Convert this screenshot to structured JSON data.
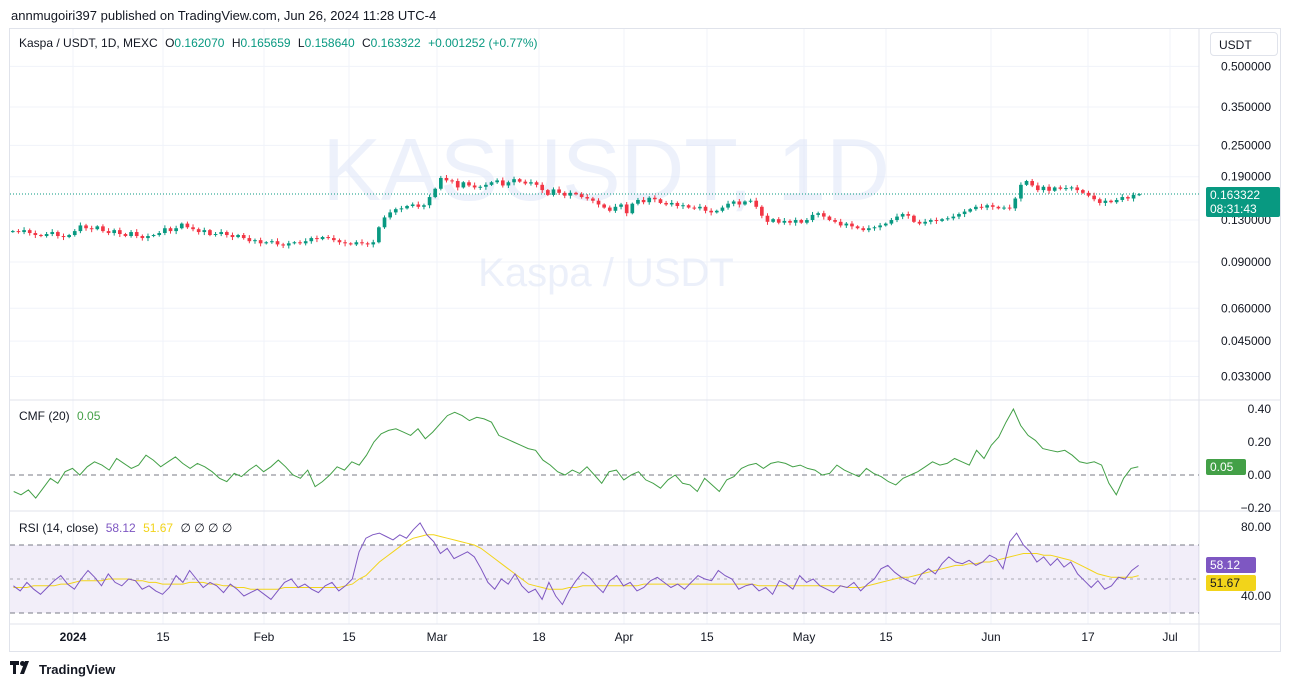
{
  "publisher_line": "annmugoiri397 published on TradingView.com, Jun 26, 2024 11:28 UTC-4",
  "legend": {
    "symbol": "Kaspa / USDT, 1D, MEXC",
    "o_label": "O",
    "o_value": "0.162070",
    "h_label": "H",
    "h_value": "0.165659",
    "l_label": "L",
    "l_value": "0.158640",
    "c_label": "C",
    "c_value": "0.163322",
    "change": "+0.001252 (+0.77%)"
  },
  "currency_button": "USDT",
  "watermark": {
    "line1": "KASUSDT, 1D",
    "line2": "Kaspa / USDT"
  },
  "price_badge": {
    "price": "0.163322",
    "countdown": "08:31:43"
  },
  "cmf": {
    "label": "CMF (20)",
    "value": "0.05"
  },
  "rsi": {
    "label": "RSI (14, close)",
    "value": "58.12",
    "ma_value": "51.67",
    "extras": "∅ ∅ ∅ ∅"
  },
  "footer_brand": "TradingView",
  "colors": {
    "up": "#089981",
    "down": "#f23645",
    "cmf": "#43a047",
    "rsi": "#7e57c2",
    "rsi_ma": "#f2d41a"
  },
  "chart_data": [
    {
      "type": "candlestick",
      "title": "Kaspa / USDT, 1D, MEXC",
      "y_scale": "log",
      "y_ticks": [
        "0.500000",
        "0.350000",
        "0.250000",
        "0.190000",
        "0.130000",
        "0.090000",
        "0.060000",
        "0.045000",
        "0.033000"
      ],
      "x_ticks": [
        "2024",
        "15",
        "Feb",
        "15",
        "Mar",
        "18",
        "Apr",
        "15",
        "May",
        "15",
        "Jun",
        "17",
        "Jul"
      ],
      "close": [
        0.118,
        0.117,
        0.119,
        0.116,
        0.114,
        0.113,
        0.115,
        0.117,
        0.113,
        0.112,
        0.114,
        0.118,
        0.124,
        0.121,
        0.12,
        0.123,
        0.118,
        0.116,
        0.119,
        0.115,
        0.113,
        0.117,
        0.113,
        0.111,
        0.113,
        0.114,
        0.116,
        0.121,
        0.118,
        0.121,
        0.126,
        0.122,
        0.12,
        0.117,
        0.119,
        0.114,
        0.115,
        0.117,
        0.114,
        0.112,
        0.114,
        0.111,
        0.108,
        0.109,
        0.106,
        0.107,
        0.108,
        0.105,
        0.104,
        0.106,
        0.107,
        0.106,
        0.108,
        0.111,
        0.11,
        0.112,
        0.111,
        0.109,
        0.107,
        0.106,
        0.105,
        0.107,
        0.106,
        0.105,
        0.107,
        0.122,
        0.133,
        0.139,
        0.143,
        0.144,
        0.147,
        0.149,
        0.146,
        0.148,
        0.159,
        0.171,
        0.188,
        0.184,
        0.183,
        0.173,
        0.181,
        0.176,
        0.173,
        0.174,
        0.177,
        0.181,
        0.184,
        0.176,
        0.181,
        0.186,
        0.182,
        0.179,
        0.181,
        0.177,
        0.169,
        0.162,
        0.17,
        0.165,
        0.161,
        0.165,
        0.163,
        0.159,
        0.157,
        0.154,
        0.149,
        0.145,
        0.141,
        0.146,
        0.149,
        0.138,
        0.15,
        0.155,
        0.152,
        0.158,
        0.156,
        0.151,
        0.149,
        0.151,
        0.147,
        0.148,
        0.145,
        0.144,
        0.146,
        0.141,
        0.139,
        0.141,
        0.145,
        0.15,
        0.153,
        0.149,
        0.153,
        0.154,
        0.146,
        0.135,
        0.128,
        0.131,
        0.127,
        0.129,
        0.127,
        0.13,
        0.127,
        0.13,
        0.136,
        0.138,
        0.134,
        0.13,
        0.128,
        0.124,
        0.126,
        0.123,
        0.121,
        0.119,
        0.121,
        0.122,
        0.124,
        0.126,
        0.13,
        0.134,
        0.137,
        0.135,
        0.128,
        0.126,
        0.128,
        0.13,
        0.129,
        0.131,
        0.132,
        0.134,
        0.137,
        0.14,
        0.143,
        0.146,
        0.145,
        0.148,
        0.146,
        0.144,
        0.145,
        0.144,
        0.157,
        0.177,
        0.183,
        0.176,
        0.169,
        0.174,
        0.168,
        0.173,
        0.171,
        0.172,
        0.173,
        0.169,
        0.165,
        0.161,
        0.156,
        0.151,
        0.154,
        0.152,
        0.155,
        0.159,
        0.157,
        0.162,
        0.163
      ]
    },
    {
      "type": "line",
      "title": "CMF (20)",
      "y_ticks": [
        "0.40",
        "0.20",
        "0.00",
        "−0.20"
      ],
      "values": [
        -0.1,
        -0.12,
        -0.09,
        -0.14,
        -0.08,
        -0.02,
        -0.05,
        0.02,
        0.04,
        0.0,
        0.05,
        0.08,
        0.06,
        0.03,
        0.1,
        0.07,
        0.04,
        0.06,
        0.12,
        0.09,
        0.05,
        0.08,
        0.11,
        0.07,
        0.04,
        0.07,
        0.05,
        0.02,
        -0.02,
        -0.04,
        0.01,
        -0.01,
        0.03,
        0.06,
        0.02,
        0.05,
        0.09,
        0.05,
        0.0,
        -0.02,
        0.03,
        -0.07,
        -0.04,
        0.0,
        0.05,
        0.03,
        0.08,
        0.06,
        0.12,
        0.2,
        0.25,
        0.27,
        0.28,
        0.26,
        0.24,
        0.28,
        0.22,
        0.26,
        0.31,
        0.36,
        0.38,
        0.36,
        0.33,
        0.35,
        0.34,
        0.32,
        0.24,
        0.22,
        0.2,
        0.18,
        0.16,
        0.15,
        0.09,
        0.06,
        0.02,
        0.0,
        0.03,
        0.01,
        0.05,
        0.0,
        -0.05,
        0.02,
        0.03,
        -0.03,
        0.0,
        0.02,
        -0.03,
        -0.05,
        -0.08,
        -0.03,
        0.0,
        -0.05,
        -0.06,
        -0.1,
        -0.02,
        -0.06,
        -0.1,
        -0.03,
        -0.01,
        0.04,
        0.06,
        0.07,
        0.04,
        0.07,
        0.08,
        0.07,
        0.05,
        0.06,
        0.04,
        0.03,
        0.0,
        0.01,
        0.06,
        0.03,
        0.01,
        -0.01,
        0.04,
        0.01,
        -0.01,
        -0.04,
        -0.06,
        -0.02,
        0.0,
        0.02,
        0.05,
        0.08,
        0.06,
        0.07,
        0.1,
        0.08,
        0.06,
        0.15,
        0.1,
        0.18,
        0.23,
        0.32,
        0.4,
        0.3,
        0.24,
        0.21,
        0.16,
        0.15,
        0.14,
        0.15,
        0.12,
        0.08,
        0.07,
        0.08,
        0.06,
        -0.05,
        -0.12,
        -0.02,
        0.04,
        0.05
      ]
    },
    {
      "type": "line",
      "title": "RSI (14, close)",
      "y_ticks": [
        "80.00",
        "40.00"
      ],
      "series": [
        {
          "name": "RSI",
          "values": [
            46,
            43,
            48,
            44,
            41,
            45,
            49,
            52,
            47,
            44,
            50,
            55,
            51,
            46,
            53,
            48,
            46,
            50,
            49,
            44,
            46,
            43,
            41,
            45,
            52,
            48,
            55,
            50,
            45,
            48,
            46,
            42,
            47,
            44,
            40,
            42,
            44,
            41,
            38,
            43,
            48,
            50,
            45,
            47,
            44,
            42,
            46,
            48,
            43,
            46,
            50,
            66,
            74,
            76,
            77,
            75,
            73,
            76,
            74,
            79,
            83,
            76,
            72,
            65,
            68,
            62,
            64,
            66,
            63,
            56,
            48,
            44,
            50,
            47,
            53,
            46,
            42,
            44,
            38,
            48,
            40,
            35,
            43,
            49,
            54,
            51,
            46,
            42,
            49,
            52,
            46,
            48,
            43,
            45,
            49,
            51,
            48,
            45,
            47,
            44,
            48,
            52,
            50,
            49,
            55,
            52,
            50,
            44,
            46,
            47,
            43,
            45,
            41,
            49,
            47,
            44,
            52,
            48,
            50,
            46,
            44,
            42,
            46,
            45,
            48,
            43,
            47,
            50,
            56,
            58,
            54,
            51,
            49,
            47,
            53,
            56,
            53,
            59,
            63,
            60,
            59,
            61,
            58,
            60,
            64,
            62,
            56,
            72,
            77,
            70,
            66,
            60,
            63,
            58,
            62,
            57,
            60,
            53,
            49,
            45,
            49,
            44,
            46,
            51,
            50,
            55,
            58
          ]
        },
        {
          "name": "RSI MA",
          "values": [
            45,
            45,
            45,
            46,
            46,
            46,
            46,
            47,
            47,
            48,
            49,
            49,
            49,
            49,
            50,
            50,
            50,
            50,
            49,
            49,
            48,
            48,
            47,
            47,
            47,
            47,
            48,
            48,
            48,
            47,
            47,
            46,
            46,
            45,
            45,
            44,
            44,
            44,
            44,
            44,
            45,
            45,
            45,
            45,
            45,
            45,
            45,
            45,
            45,
            46,
            47,
            50,
            52,
            56,
            60,
            63,
            66,
            69,
            72,
            74,
            75,
            76,
            76,
            75,
            74,
            73,
            72,
            71,
            70,
            68,
            65,
            62,
            59,
            56,
            53,
            50,
            47,
            46,
            45,
            44,
            44,
            44,
            45,
            45,
            46,
            46,
            46,
            46,
            46,
            46,
            46,
            46,
            46,
            47,
            47,
            47,
            47,
            47,
            47,
            47,
            47,
            47,
            47,
            47,
            47,
            47,
            47,
            47,
            47,
            47,
            46,
            46,
            46,
            46,
            46,
            46,
            46,
            46,
            46,
            46,
            46,
            46,
            46,
            45,
            45,
            45,
            46,
            47,
            48,
            49,
            50,
            51,
            51,
            52,
            53,
            54,
            55,
            56,
            57,
            58,
            58,
            59,
            59,
            60,
            60,
            61,
            62,
            63,
            64,
            65,
            65,
            65,
            64,
            64,
            63,
            62,
            61,
            59,
            57,
            55,
            53,
            52,
            51,
            51,
            51,
            51,
            52
          ]
        }
      ]
    }
  ]
}
